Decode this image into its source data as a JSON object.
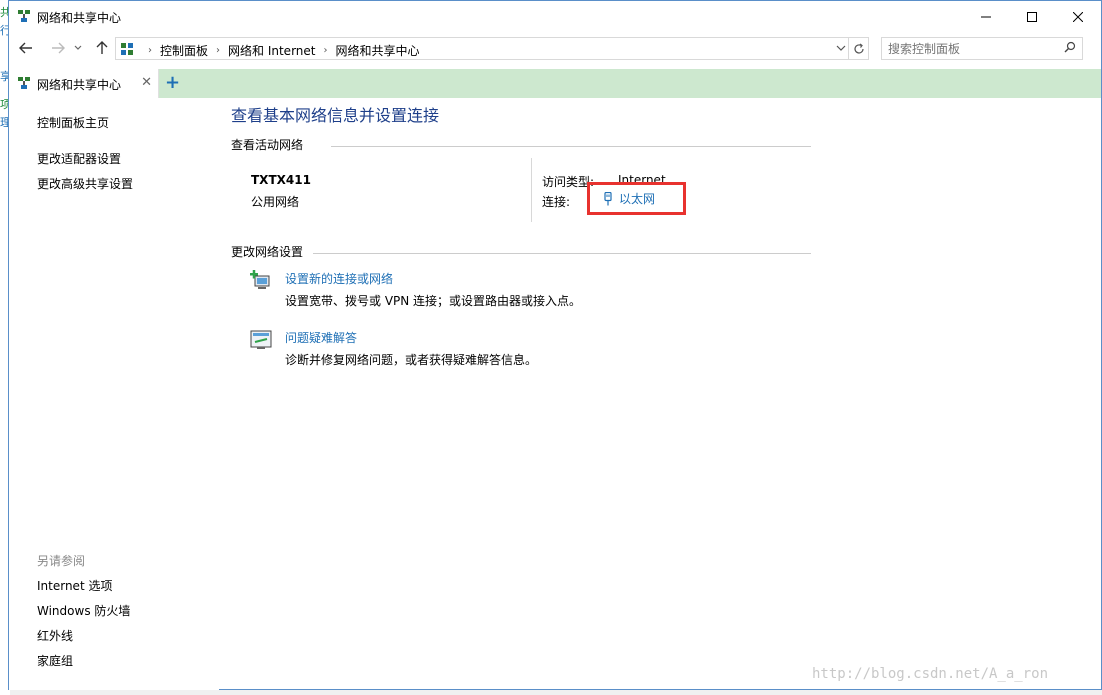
{
  "behind": {
    "chars": [
      "共",
      "行",
      "享",
      "项",
      "理"
    ]
  },
  "window": {
    "title": "网络和共享中心"
  },
  "nav": {
    "crumbs": [
      "控制面板",
      "网络和 Internet",
      "网络和共享中心"
    ],
    "search_placeholder": "搜索控制面板"
  },
  "tab": {
    "label": "网络和共享中心",
    "close": "✕",
    "new": "+"
  },
  "sidebar": {
    "home": "控制面板主页",
    "adapter": "更改适配器设置",
    "sharing": "更改高级共享设置",
    "see_also": "另请参阅",
    "links": [
      "Internet 选项",
      "Windows 防火墙",
      "红外线",
      "家庭组"
    ]
  },
  "main": {
    "title": "查看基本网络信息并设置连接",
    "active_head": "查看活动网络",
    "network_name": "TXTX411",
    "network_type": "公用网络",
    "access_label": "访问类型:",
    "access_value": "Internet",
    "conn_label": "连接:",
    "conn_value": "以太网",
    "change_head": "更改网络设置",
    "tasks": [
      {
        "link": "设置新的连接或网络",
        "desc": "设置宽带、拨号或 VPN 连接；或设置路由器或接入点。"
      },
      {
        "link": "问题疑难解答",
        "desc": "诊断并修复网络问题，或者获得疑难解答信息。"
      }
    ]
  },
  "watermark": "http://blog.csdn.net/A_a_ron",
  "colors": {
    "link": "#1e6fb5",
    "title": "#1e3f8a",
    "tabbar": "#cde8cf",
    "highlight": "#e8322f"
  }
}
